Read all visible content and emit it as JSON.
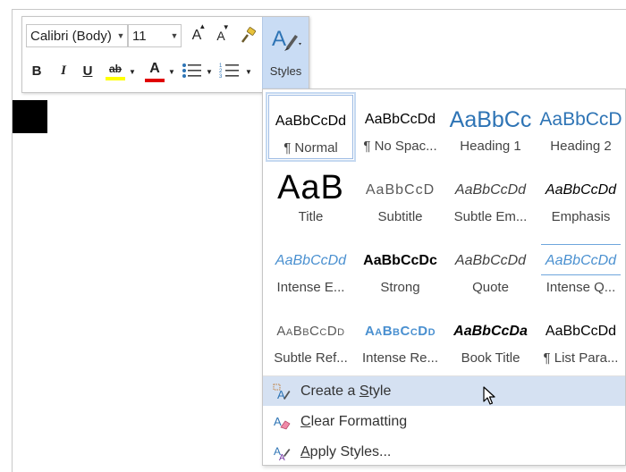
{
  "toolbar": {
    "font_name": "Calibri (Body)",
    "font_size": "11",
    "grow_font_glyph": "A",
    "shrink_font_glyph": "A",
    "bold_glyph": "B",
    "italic_glyph": "I",
    "underline_glyph": "U",
    "highlight_glyph": "ab",
    "font_color_glyph": "A",
    "styles_label": "Styles",
    "highlight_color": "#ffff00",
    "font_color": "#e00000"
  },
  "gallery": {
    "styles": [
      {
        "preview": "AaBbCcDd",
        "name": "¶ Normal"
      },
      {
        "preview": "AaBbCcDd",
        "name": "¶ No Spac..."
      },
      {
        "preview": "AaBbCc",
        "name": "Heading 1"
      },
      {
        "preview": "AaBbCcD",
        "name": "Heading 2"
      },
      {
        "preview": "AaB",
        "name": "Title"
      },
      {
        "preview": "AaBbCcD",
        "name": "Subtitle"
      },
      {
        "preview": "AaBbCcDd",
        "name": "Subtle Em..."
      },
      {
        "preview": "AaBbCcDd",
        "name": "Emphasis"
      },
      {
        "preview": "AaBbCcDd",
        "name": "Intense E..."
      },
      {
        "preview": "AaBbCcDc",
        "name": "Strong"
      },
      {
        "preview": "AaBbCcDd",
        "name": "Quote"
      },
      {
        "preview": "AaBbCcDd",
        "name": "Intense Q..."
      },
      {
        "preview": "AaBbCcDd",
        "name": "Subtle Ref..."
      },
      {
        "preview": "AaBbCcDd",
        "name": "Intense Re..."
      },
      {
        "preview": "AaBbCcDa",
        "name": "Book Title"
      },
      {
        "preview": "AaBbCcDd",
        "name": "¶ List Para..."
      }
    ],
    "menu": [
      {
        "pre": "Create a ",
        "key": "S",
        "post": "tyle"
      },
      {
        "pre": "",
        "key": "C",
        "post": "lear Formatting"
      },
      {
        "pre": "",
        "key": "A",
        "post": "pply Styles..."
      }
    ]
  }
}
